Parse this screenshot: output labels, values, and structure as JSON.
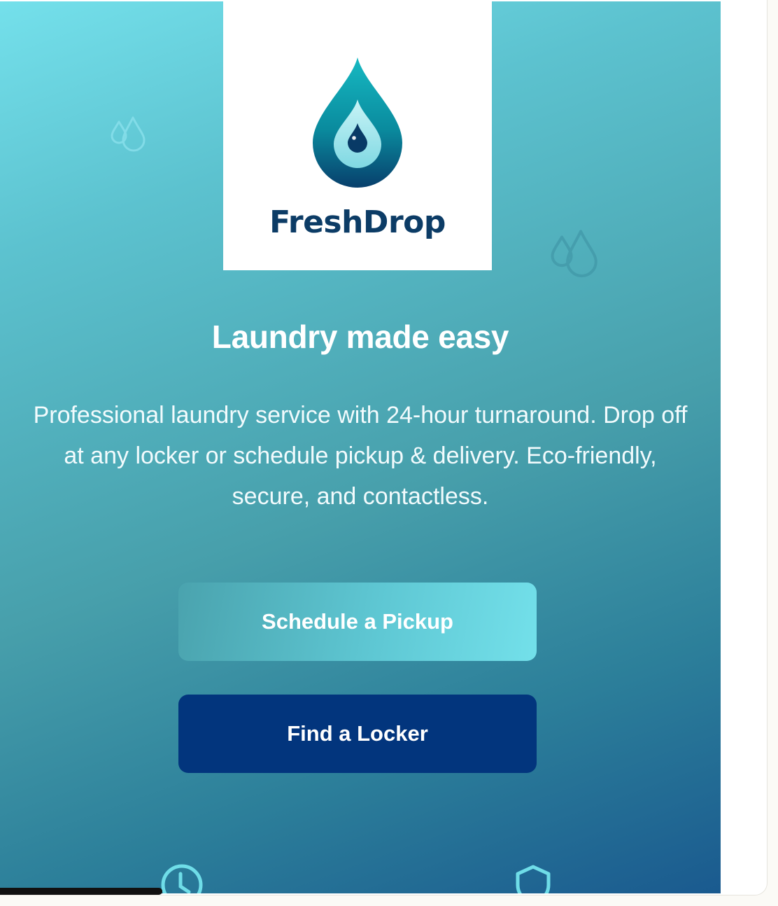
{
  "brand": {
    "name": "FreshDrop"
  },
  "hero": {
    "headline": "Laundry made easy",
    "description": "Professional laundry service with 24-hour turnaround. Drop off at any locker or schedule pickup & delivery. Eco-friendly, secure, and contactless."
  },
  "actions": {
    "schedule_pickup": "Schedule a Pickup",
    "find_locker": "Find a Locker"
  },
  "icons": [
    "water-drops-icon",
    "freshdrop-logo-drop-icon",
    "clock-icon",
    "shield-icon"
  ],
  "colors": {
    "brand_navy": "#0c3c66",
    "primary_button": "#02357d",
    "accent_cyan": "#73e0ea",
    "hero_gradient_start": "#74e0eb",
    "hero_gradient_end": "#1a5a8f"
  }
}
